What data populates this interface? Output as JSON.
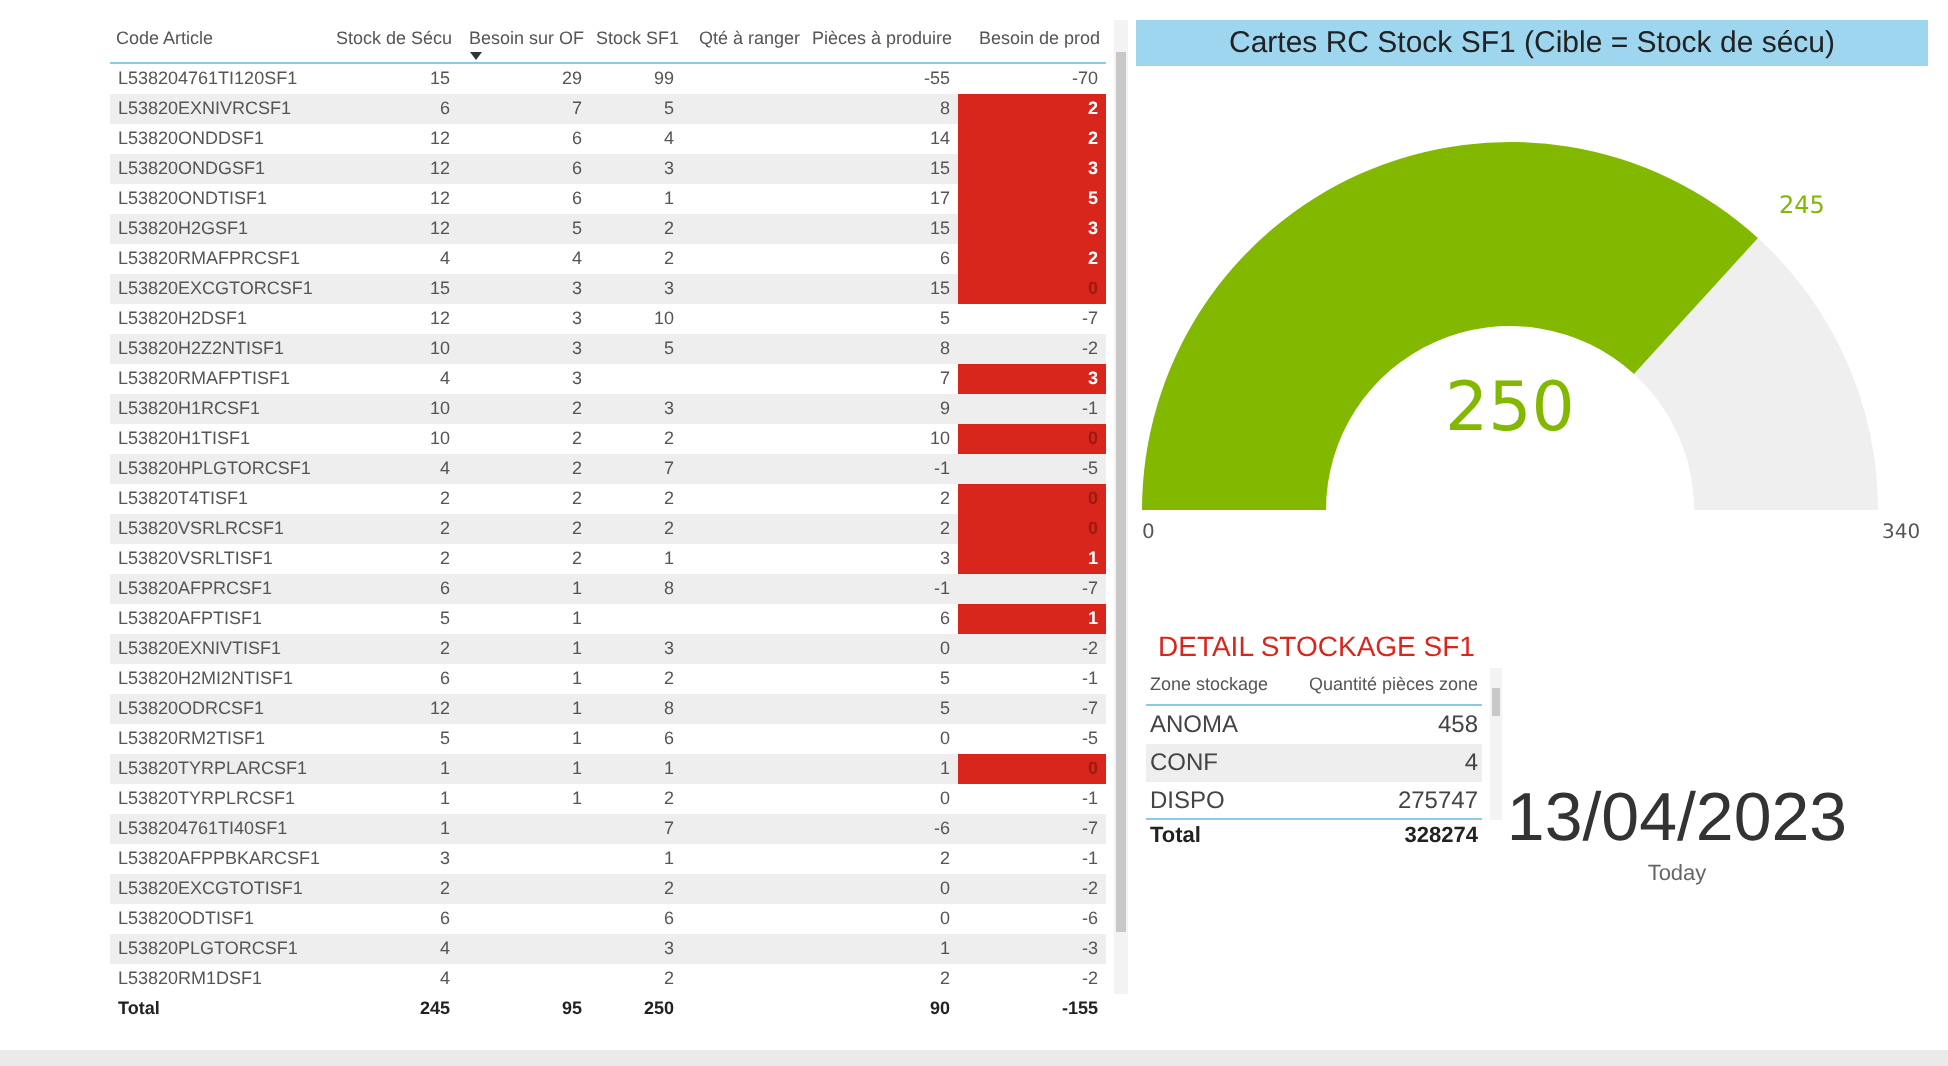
{
  "table": {
    "columns": [
      {
        "label": "Code Article",
        "sorted": false
      },
      {
        "label": "Stock de Sécu",
        "sorted": false
      },
      {
        "label": "Besoin sur OF",
        "sorted": true
      },
      {
        "label": "Stock SF1",
        "sorted": false
      },
      {
        "label": "Qté à ranger",
        "sorted": false
      },
      {
        "label": "Pièces à produire",
        "sorted": false
      },
      {
        "label": "Besoin de prod",
        "sorted": false
      }
    ],
    "rows": [
      {
        "cells": [
          "L538204761TI120SF1",
          "15",
          "29",
          "99",
          "",
          "-55",
          "-70"
        ],
        "highlighted": false
      },
      {
        "cells": [
          "L53820EXNIVRCSF1",
          "6",
          "7",
          "5",
          "",
          "8",
          "2"
        ],
        "highlighted": true
      },
      {
        "cells": [
          "L53820ONDDSF1",
          "12",
          "6",
          "4",
          "",
          "14",
          "2"
        ],
        "highlighted": true
      },
      {
        "cells": [
          "L53820ONDGSF1",
          "12",
          "6",
          "3",
          "",
          "15",
          "3"
        ],
        "highlighted": true
      },
      {
        "cells": [
          "L53820ONDTISF1",
          "12",
          "6",
          "1",
          "",
          "17",
          "5"
        ],
        "highlighted": true
      },
      {
        "cells": [
          "L53820H2GSF1",
          "12",
          "5",
          "2",
          "",
          "15",
          "3"
        ],
        "highlighted": true
      },
      {
        "cells": [
          "L53820RMAFPRCSF1",
          "4",
          "4",
          "2",
          "",
          "6",
          "2"
        ],
        "highlighted": true
      },
      {
        "cells": [
          "L53820EXCGTORCSF1",
          "15",
          "3",
          "3",
          "",
          "15",
          "0"
        ],
        "highlighted": true
      },
      {
        "cells": [
          "L53820H2DSF1",
          "12",
          "3",
          "10",
          "",
          "5",
          "-7"
        ],
        "highlighted": false
      },
      {
        "cells": [
          "L53820H2Z2NTISF1",
          "10",
          "3",
          "5",
          "",
          "8",
          "-2"
        ],
        "highlighted": false
      },
      {
        "cells": [
          "L53820RMAFPTISF1",
          "4",
          "3",
          "",
          "",
          "7",
          "3"
        ],
        "highlighted": true
      },
      {
        "cells": [
          "L53820H1RCSF1",
          "10",
          "2",
          "3",
          "",
          "9",
          "-1"
        ],
        "highlighted": false
      },
      {
        "cells": [
          "L53820H1TISF1",
          "10",
          "2",
          "2",
          "",
          "10",
          "0"
        ],
        "highlighted": true
      },
      {
        "cells": [
          "L53820HPLGTORCSF1",
          "4",
          "2",
          "7",
          "",
          "-1",
          "-5"
        ],
        "highlighted": false
      },
      {
        "cells": [
          "L53820T4TISF1",
          "2",
          "2",
          "2",
          "",
          "2",
          "0"
        ],
        "highlighted": true
      },
      {
        "cells": [
          "L53820VSRLRCSF1",
          "2",
          "2",
          "2",
          "",
          "2",
          "0"
        ],
        "highlighted": true
      },
      {
        "cells": [
          "L53820VSRLTISF1",
          "2",
          "2",
          "1",
          "",
          "3",
          "1"
        ],
        "highlighted": true
      },
      {
        "cells": [
          "L53820AFPRCSF1",
          "6",
          "1",
          "8",
          "",
          "-1",
          "-7"
        ],
        "highlighted": false
      },
      {
        "cells": [
          "L53820AFPTISF1",
          "5",
          "1",
          "",
          "",
          "6",
          "1"
        ],
        "highlighted": true
      },
      {
        "cells": [
          "L53820EXNIVTISF1",
          "2",
          "1",
          "3",
          "",
          "0",
          "-2"
        ],
        "highlighted": false
      },
      {
        "cells": [
          "L53820H2MI2NTISF1",
          "6",
          "1",
          "2",
          "",
          "5",
          "-1"
        ],
        "highlighted": false
      },
      {
        "cells": [
          "L53820ODRCSF1",
          "12",
          "1",
          "8",
          "",
          "5",
          "-7"
        ],
        "highlighted": false
      },
      {
        "cells": [
          "L53820RM2TISF1",
          "5",
          "1",
          "6",
          "",
          "0",
          "-5"
        ],
        "highlighted": false
      },
      {
        "cells": [
          "L53820TYRPLARCSF1",
          "1",
          "1",
          "1",
          "",
          "1",
          "0"
        ],
        "highlighted": true
      },
      {
        "cells": [
          "L53820TYRPLRCSF1",
          "1",
          "1",
          "2",
          "",
          "0",
          "-1"
        ],
        "highlighted": false
      },
      {
        "cells": [
          "L538204761TI40SF1",
          "1",
          "",
          "7",
          "",
          "-6",
          "-7"
        ],
        "highlighted": false
      },
      {
        "cells": [
          "L53820AFPPBKARCSF1",
          "3",
          "",
          "1",
          "",
          "2",
          "-1"
        ],
        "highlighted": false
      },
      {
        "cells": [
          "L53820EXCGTOTISF1",
          "2",
          "",
          "2",
          "",
          "0",
          "-2"
        ],
        "highlighted": false
      },
      {
        "cells": [
          "L53820ODTISF1",
          "6",
          "",
          "6",
          "",
          "0",
          "-6"
        ],
        "highlighted": false
      },
      {
        "cells": [
          "L53820PLGTORCSF1",
          "4",
          "",
          "3",
          "",
          "1",
          "-3"
        ],
        "highlighted": false
      },
      {
        "cells": [
          "L53820RM1DSF1",
          "4",
          "",
          "2",
          "",
          "2",
          "-2"
        ],
        "highlighted": false
      }
    ],
    "total": {
      "label": "Total",
      "stock_de_secu": "245",
      "besoin_sur_of": "95",
      "stock_sf1": "250",
      "pieces_a_produire": "90",
      "besoin_de_prod": "-155"
    }
  },
  "gauge": {
    "title": "Cartes RC Stock SF1 (Cible = Stock de sécu)",
    "value": "250",
    "target": "245",
    "min": "0",
    "max": "340"
  },
  "detail": {
    "title": "DETAIL STOCKAGE SF1",
    "columns": [
      "Zone stockage",
      "Quantité pièces zone"
    ],
    "rows": [
      [
        "ANOMA",
        "458"
      ],
      [
        "CONF",
        "4"
      ],
      [
        "DISPO",
        "275747"
      ]
    ],
    "total": [
      "Total",
      "328274"
    ]
  },
  "date_card": {
    "value": "13/04/2023",
    "label": "Today"
  }
}
